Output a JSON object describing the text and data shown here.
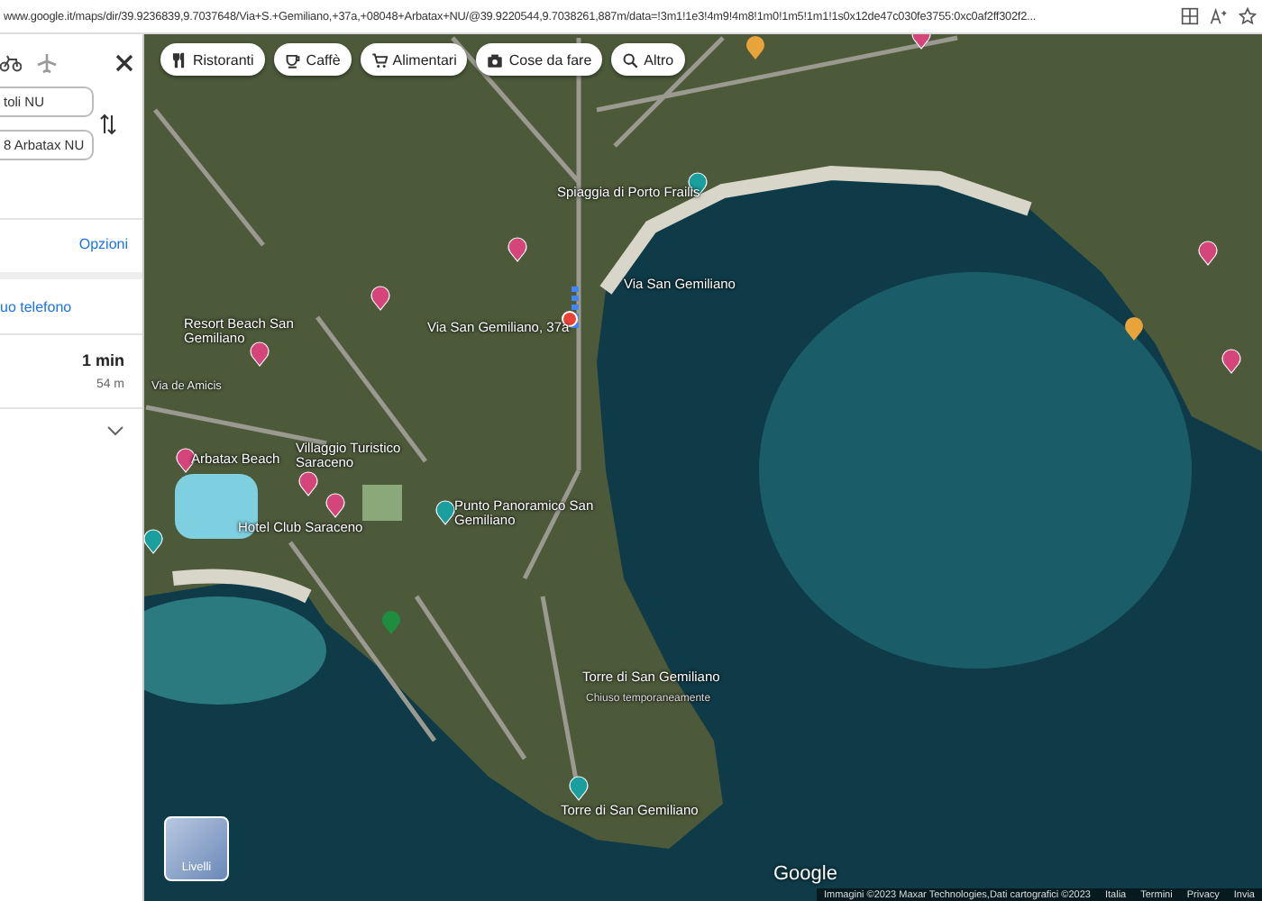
{
  "browser": {
    "url": "www.google.it/maps/dir/39.9236839,9.7037648/Via+S.+Gemiliano,+37a,+08048+Arbatax+NU/@39.9220544,9.7038261,887m/data=!3m1!1e3!4m9!4m8!1m0!1m5!1m1!1s0x12de47c030fe3755:0xc0af2ff302f2..."
  },
  "directions_panel": {
    "fields": [
      {
        "value": "toli NU"
      },
      {
        "value": "8 Arbatax NU"
      }
    ],
    "options_link": "Opzioni",
    "phone_link": "uo telefono",
    "route": {
      "duration": "1 min",
      "distance": "54 m"
    }
  },
  "chips": [
    {
      "label": "Ristoranti",
      "kind": "restaurant"
    },
    {
      "label": "Caffè",
      "kind": "cafe"
    },
    {
      "label": "Alimentari",
      "kind": "cart"
    },
    {
      "label": "Cose da fare",
      "kind": "camera"
    },
    {
      "label": "Altro",
      "kind": "search"
    }
  ],
  "map": {
    "labels": [
      {
        "text": "Spiaggia di Porto Frailis",
        "kind": "place"
      },
      {
        "text": "Via San Gemiliano",
        "kind": "place"
      },
      {
        "text": "Resort Beach San Gemiliano",
        "kind": "place"
      },
      {
        "text": "Via San Gemiliano, 37a",
        "kind": "place"
      },
      {
        "text": "Arbatax Beach",
        "kind": "place"
      },
      {
        "text": "Villaggio Turistico Saraceno",
        "kind": "place"
      },
      {
        "text": "Hotel Club Saraceno",
        "kind": "place"
      },
      {
        "text": "Punto Panoramico San Gemiliano",
        "kind": "place"
      },
      {
        "text": "Torre di San Gemiliano",
        "kind": "place"
      },
      {
        "text": "Chiuso temporaneamente",
        "kind": "note"
      },
      {
        "text": "Torre di San Gemiliano",
        "kind": "place"
      },
      {
        "text": "Via de Amicis",
        "kind": "street"
      }
    ],
    "layers_button": "Livelli",
    "logo": "Google",
    "attribution": "Immagini ©2023 Maxar Technologies,Dati cartografici ©2023",
    "footer_links": [
      "Italia",
      "Termini",
      "Privacy",
      "Invia"
    ]
  }
}
